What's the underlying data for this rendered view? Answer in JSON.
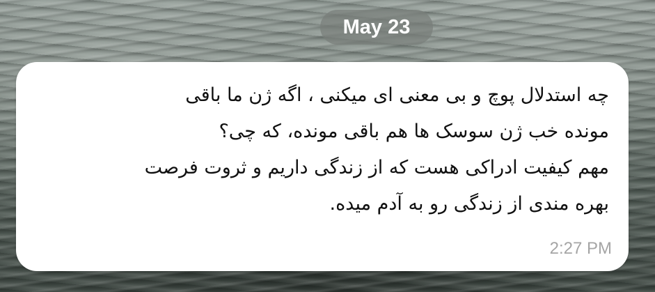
{
  "date_separator": "May 23",
  "message": {
    "lines": [
      "چه استدلال پوچ و بی معنی ای میکنی ، اگه ژن ما باقی",
      "مونده خب ژن سوسک ها هم باقی مونده، که چی؟",
      "مهم کیفیت ادراکی هست که از زندگی داریم و ثروت فرصت",
      "بهره مندی از زندگی رو به آدم میده."
    ],
    "time": "2:27 PM"
  },
  "colors": {
    "bubble_background": "#ffffff",
    "text": "#111111",
    "timestamp": "#a5a5a5",
    "date_pill_background": "#7e8680"
  }
}
